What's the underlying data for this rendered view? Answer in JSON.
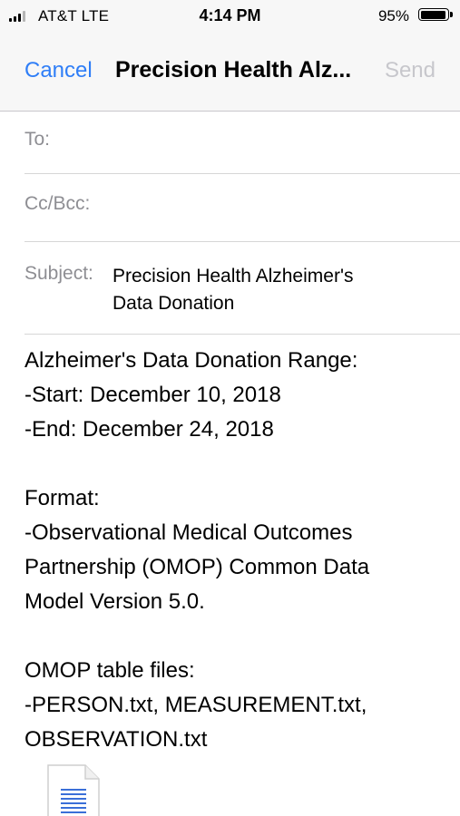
{
  "status_bar": {
    "carrier": "AT&T  LTE",
    "time": "4:14 PM",
    "battery_percent": "95%",
    "battery_level": 0.95,
    "signal_bars_filled": 3,
    "signal_bars_total": 4
  },
  "nav": {
    "cancel_label": "Cancel",
    "title": "Precision Health Alz...",
    "send_label": "Send"
  },
  "fields": {
    "to_label": "To:",
    "cc_label": "Cc/Bcc:",
    "subject_label": "Subject:",
    "subject_line1": "Precision Health Alzheimer's",
    "subject_line2": "Data Donation"
  },
  "body": {
    "line1": "Alzheimer's Data Donation Range:",
    "line2": "-Start: December 10, 2018",
    "line3": "-End: December 24, 2018",
    "line4": "Format:",
    "line5": "-Observational Medical Outcomes",
    "line6": "Partnership (OMOP) Common Data",
    "line7": "Model Version 5.0.",
    "line8": "OMOP table files:",
    "line9": "-PERSON.txt, MEASUREMENT.txt,",
    "line10": "OBSERVATION.txt"
  },
  "attachment": {
    "icon": "document-icon"
  },
  "colors": {
    "accent": "#2f7ef7",
    "disabled": "#c7c7cc",
    "label_gray": "#8e8e93",
    "header_bg": "#f7f7f7"
  }
}
